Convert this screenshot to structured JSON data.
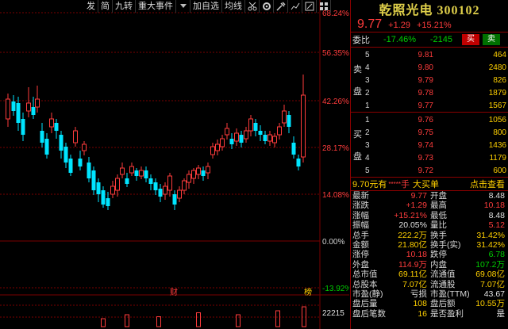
{
  "toolbar": {
    "buttons": [
      "发",
      "简",
      "九转",
      "重大事件",
      "加自选",
      "均线"
    ],
    "icons": [
      "scissors-icon",
      "settings-icon",
      "tools-icon",
      "chart-icon",
      "edit-icon",
      "grid-icon"
    ]
  },
  "chart": {
    "pct_labels": [
      "68.24%",
      "56.35%",
      "42.26%",
      "28.17%",
      "14.08%",
      "0.00%",
      "-13.92%"
    ],
    "marker_cai": "财",
    "marker_bang": "榜",
    "volume_label": "22215",
    "colors": {
      "up": "#ff3c3c",
      "down": "#00e5ff",
      "grid": "#7a0000"
    }
  },
  "panel": {
    "title": "乾照光电 300102",
    "price": "9.77",
    "change": "+1.29",
    "change_pct": "+15.21%",
    "webi": {
      "label": "委比",
      "ratio": "-17.46%",
      "diff": "-2145",
      "buy": "买",
      "sell": "卖"
    },
    "sell_side_label": [
      "卖",
      "盘"
    ],
    "buy_side_label": [
      "买",
      "盘"
    ],
    "asks": [
      {
        "level": "5",
        "price": "9.81",
        "vol": "464"
      },
      {
        "level": "4",
        "price": "9.80",
        "vol": "2480"
      },
      {
        "level": "3",
        "price": "9.79",
        "vol": "826"
      },
      {
        "level": "2",
        "price": "9.78",
        "vol": "1879"
      },
      {
        "level": "1",
        "price": "9.77",
        "vol": "1567"
      }
    ],
    "bids": [
      {
        "level": "1",
        "price": "9.76",
        "vol": "1056"
      },
      {
        "level": "2",
        "price": "9.75",
        "vol": "800"
      },
      {
        "level": "3",
        "price": "9.74",
        "vol": "1436"
      },
      {
        "level": "4",
        "price": "9.73",
        "vol": "1179"
      },
      {
        "level": "5",
        "price": "9.72",
        "vol": "600"
      }
    ],
    "trade": {
      "price": "9.70元有",
      "stars": "*****",
      "unit": "手",
      "bigbuy": "大买单",
      "check": "点击查看"
    },
    "stats": [
      {
        "l1": "最新",
        "v1": "9.77",
        "c1": "red",
        "l2": "开盘",
        "v2": "8.48",
        "c2": "white"
      },
      {
        "l1": "涨跌",
        "v1": "+1.29",
        "c1": "red",
        "l2": "最高",
        "v2": "10.18",
        "c2": "red"
      },
      {
        "l1": "涨幅",
        "v1": "+15.21%",
        "c1": "red",
        "l2": "最低",
        "v2": "8.48",
        "c2": "white"
      },
      {
        "l1": "振幅",
        "v1": "20.05%",
        "c1": "white",
        "l2": "量比",
        "v2": "5.12",
        "c2": "red"
      },
      {
        "l1": "总手",
        "v1": "222.2万",
        "c1": "yellow",
        "l2": "换手",
        "v2": "31.42%",
        "c2": "yellow"
      },
      {
        "l1": "金额",
        "v1": "21.80亿",
        "c1": "yellow",
        "l2": "换手(实)",
        "v2": "31.42%",
        "c2": "yellow"
      },
      {
        "l1": "涨停",
        "v1": "10.18",
        "c1": "red",
        "l2": "跌停",
        "v2": "6.78",
        "c2": "green"
      },
      {
        "l1": "外盘",
        "v1": "114.9万",
        "c1": "red",
        "l2": "内盘",
        "v2": "107.2万",
        "c2": "green"
      },
      {
        "l1": "总市值",
        "v1": "69.11亿",
        "c1": "yellow",
        "l2": "流通值",
        "v2": "69.08亿",
        "c2": "yellow"
      },
      {
        "l1": "总股本",
        "v1": "7.07亿",
        "c1": "yellow",
        "l2": "流通股",
        "v2": "7.07亿",
        "c2": "yellow"
      },
      {
        "l1": "市盈(静)",
        "v1": "亏损",
        "c1": "white",
        "l2": "市盈(TTM)",
        "v2": "43.67",
        "c2": "white"
      },
      {
        "l1": "盘后量",
        "v1": "108",
        "c1": "yellow",
        "l2": "盘后额",
        "v2": "10.55万",
        "c2": "yellow"
      },
      {
        "l1": "盘后笔数",
        "v1": "16",
        "c1": "yellow",
        "l2": "是否盈利",
        "v2": "是",
        "c2": "white"
      }
    ]
  }
}
